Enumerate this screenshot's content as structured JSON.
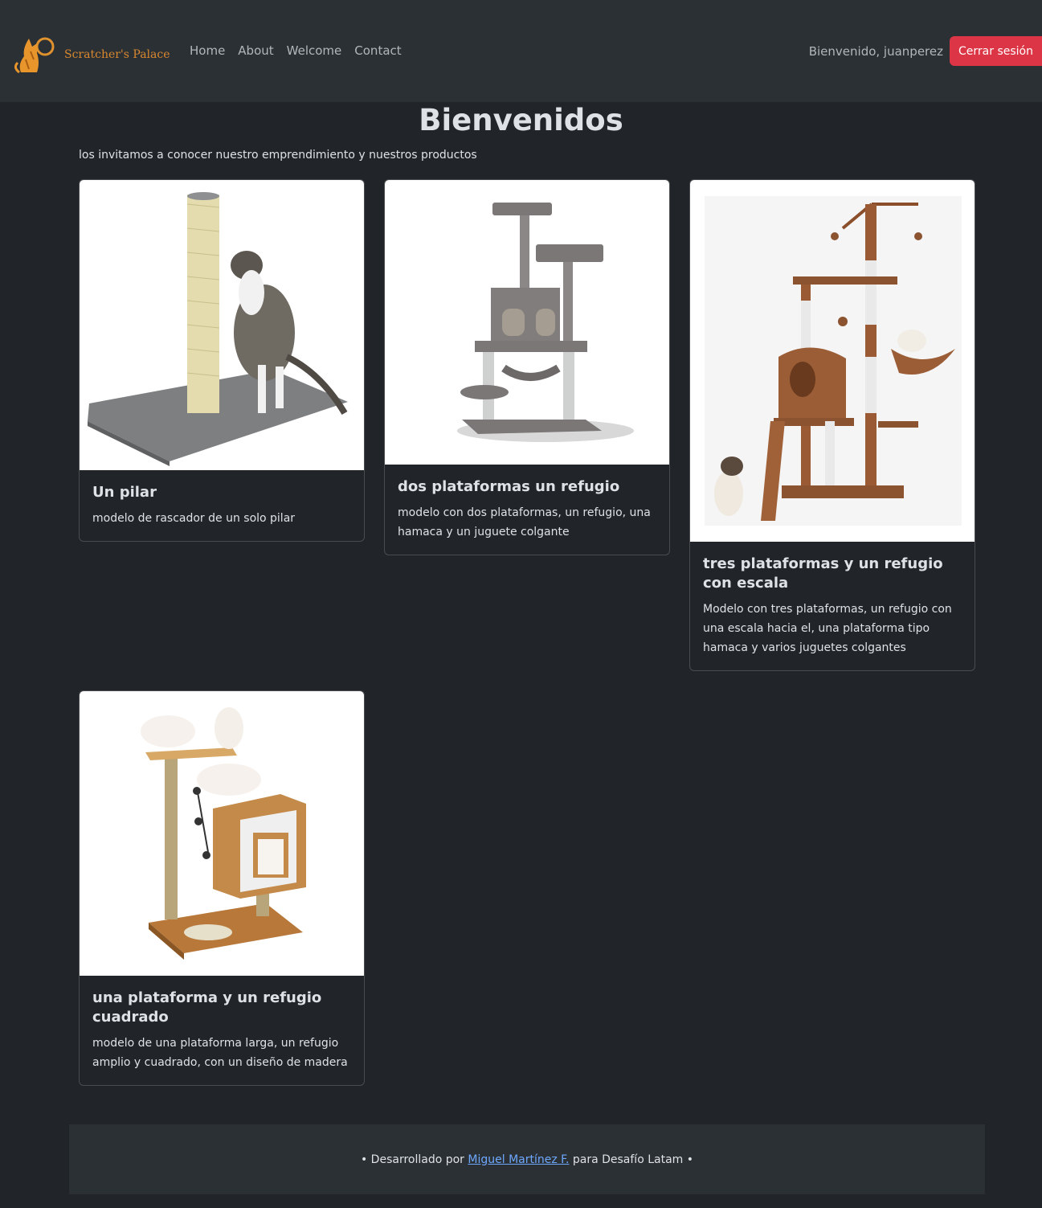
{
  "navbar": {
    "brand_name": "Scratcher's Palace",
    "logo_icon": "cat-logo-icon",
    "links": [
      "Home",
      "About",
      "Welcome",
      "Contact"
    ],
    "greeting": "Bienvenido, juanperez",
    "logout_label": "Cerrar sesión",
    "logout_color": "#dc3545",
    "brand_color": "#d9882e"
  },
  "main": {
    "title": "Bienvenidos",
    "intro": "los invitamos a conocer nuestro emprendimiento y nuestros productos",
    "cards": [
      {
        "title": "Un pilar",
        "text": "modelo de rascador de un solo pilar"
      },
      {
        "title": "dos plataformas un refugio",
        "text": "modelo con dos plataformas, un refugio, una hamaca y un juguete colgante"
      },
      {
        "title": "tres plataformas y un refugio con escala",
        "text": "Modelo con tres plataformas, un refugio con una escala hacia el, una plataforma tipo hamaca y varios juguetes colgantes"
      },
      {
        "title": "una plataforma y un refugio cuadrado",
        "text": "modelo de una plataforma larga, un refugio amplio y cuadrado, con un diseño de madera"
      }
    ]
  },
  "footer": {
    "prefix": "• Desarrollado por ",
    "author": "Miguel Martínez F.",
    "suffix": " para Desafío Latam •",
    "link_color": "#6ea8fe"
  }
}
